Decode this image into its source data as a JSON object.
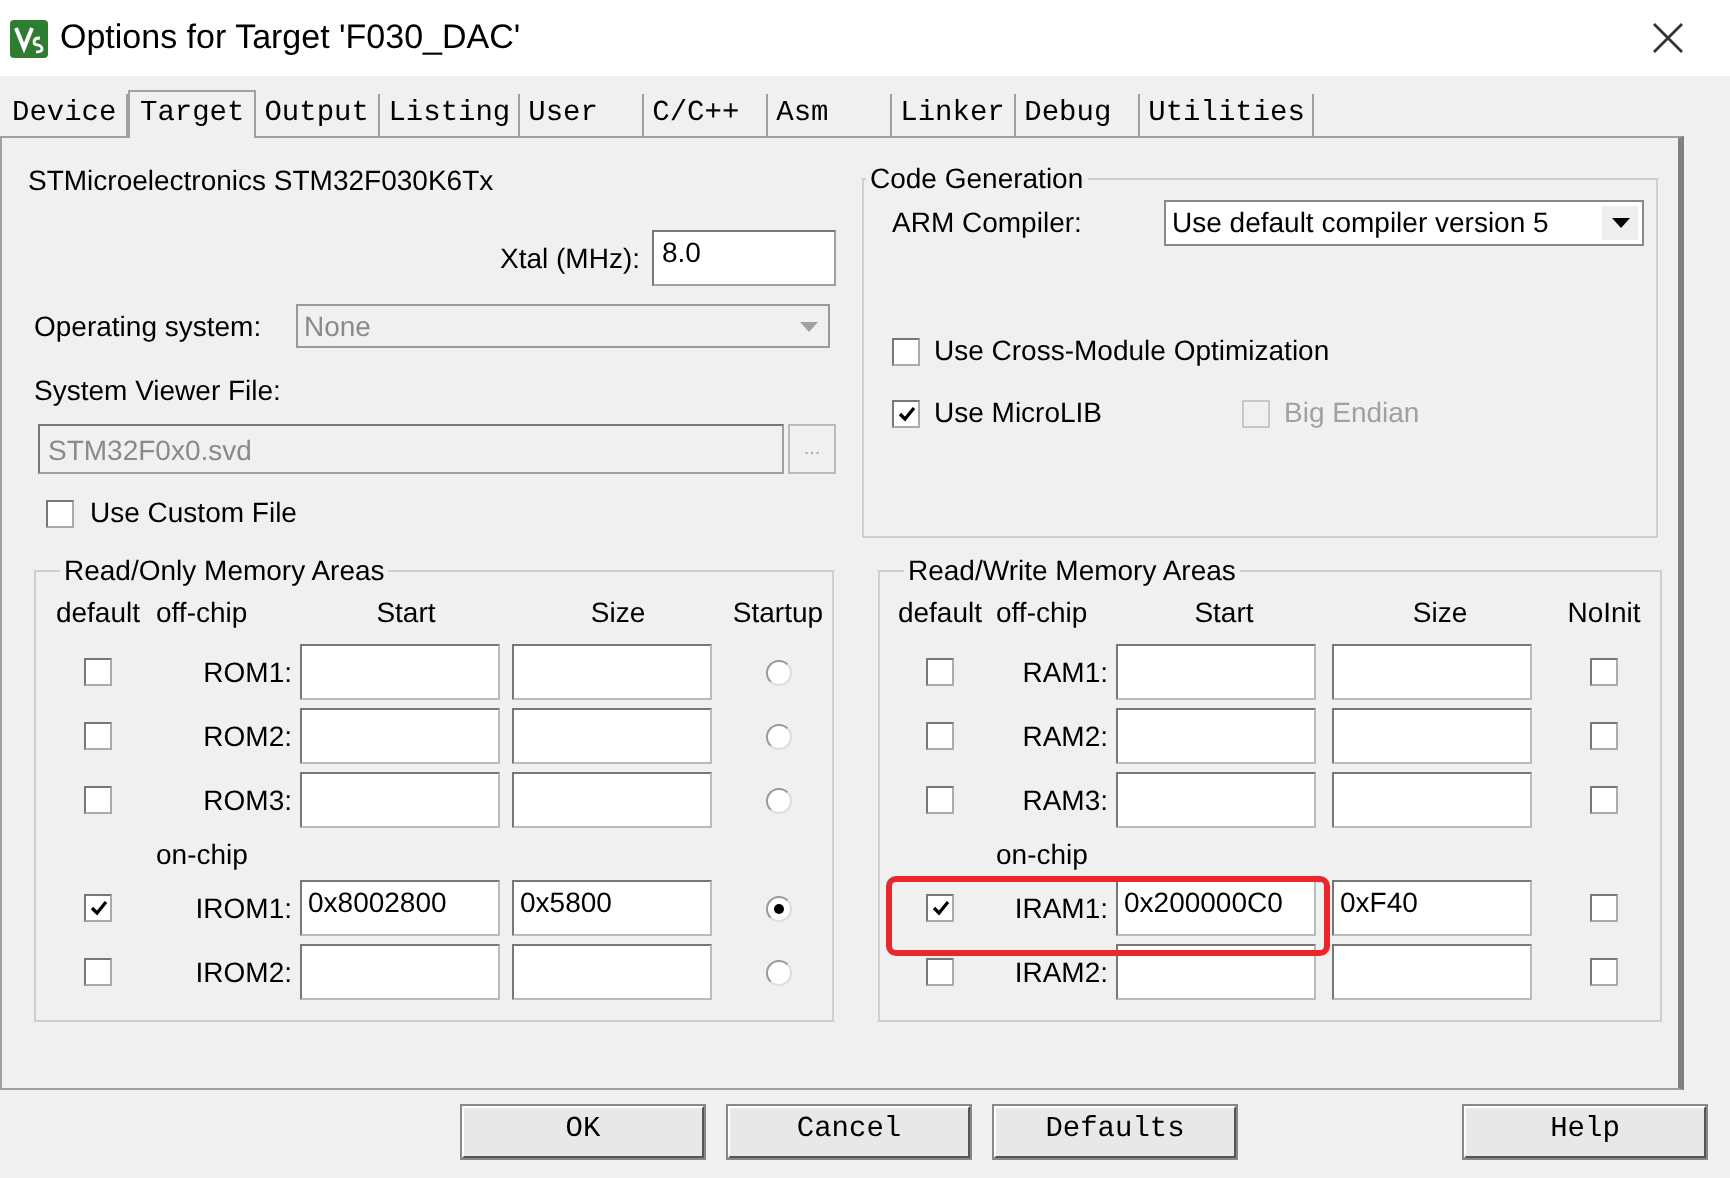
{
  "window": {
    "title": "Options for Target 'F030_DAC'"
  },
  "tabs": [
    {
      "label": "Device",
      "selected": false
    },
    {
      "label": "Target",
      "selected": true
    },
    {
      "label": "Output",
      "selected": false
    },
    {
      "label": "Listing",
      "selected": false
    },
    {
      "label": "User",
      "selected": false
    },
    {
      "label": "C/C++",
      "selected": false
    },
    {
      "label": "Asm",
      "selected": false
    },
    {
      "label": "Linker",
      "selected": false
    },
    {
      "label": "Debug",
      "selected": false
    },
    {
      "label": "Utilities",
      "selected": false
    }
  ],
  "device": {
    "name": "STMicroelectronics STM32F030K6Tx",
    "xtal": {
      "label": "Xtal (MHz):",
      "value": "8.0"
    },
    "os": {
      "label": "Operating system:",
      "value": "None",
      "disabled": true
    },
    "svd": {
      "label": "System Viewer File:",
      "value": "STM32F0x0.svd",
      "disabled": true,
      "browse": "..."
    },
    "custom_file": {
      "label": "Use Custom File",
      "checked": false
    }
  },
  "code_generation": {
    "title": "Code Generation",
    "compiler_label": "ARM Compiler:",
    "compiler": "Use default compiler version 5",
    "options": [
      {
        "label": "Use Cross-Module Optimization",
        "checked": false,
        "disabled": false
      },
      {
        "label": "Use MicroLIB",
        "checked": true,
        "disabled": false
      },
      {
        "label": "Big Endian",
        "checked": false,
        "disabled": true
      }
    ]
  },
  "memory_areas": [
    {
      "title": "Read/Only Memory Areas",
      "columns": [
        "default",
        "off-chip",
        "Start",
        "Size",
        "Startup"
      ],
      "kind": "radio",
      "onchip_label": "on-chip",
      "rows": [
        {
          "kind": "off-chip",
          "label": "ROM1:",
          "default": false,
          "last": false,
          "highlighted": false
        },
        {
          "kind": "off-chip",
          "label": "ROM2:",
          "default": false,
          "last": false,
          "highlighted": false
        },
        {
          "kind": "off-chip",
          "label": "ROM3:",
          "default": false,
          "last": false,
          "highlighted": false
        },
        {
          "kind": "on-chip",
          "label": "IROM1:",
          "default": true,
          "start": "0x8002800",
          "size": "0x5800",
          "last": true,
          "highlighted": false
        },
        {
          "kind": "on-chip",
          "label": "IROM2:",
          "default": false,
          "last": false,
          "highlighted": false
        }
      ]
    },
    {
      "title": "Read/Write Memory Areas",
      "columns": [
        "default",
        "off-chip",
        "Start",
        "Size",
        "NoInit"
      ],
      "kind": "checkbox",
      "onchip_label": "on-chip",
      "rows": [
        {
          "kind": "off-chip",
          "label": "RAM1:",
          "default": false,
          "last": false,
          "highlighted": false
        },
        {
          "kind": "off-chip",
          "label": "RAM2:",
          "default": false,
          "last": false,
          "highlighted": false
        },
        {
          "kind": "off-chip",
          "label": "RAM3:",
          "default": false,
          "last": false,
          "highlighted": false
        },
        {
          "kind": "on-chip",
          "label": "IRAM1:",
          "default": true,
          "start": "0x200000C0",
          "size": "0xF40",
          "last": false,
          "highlighted": true
        },
        {
          "kind": "on-chip",
          "label": "IRAM2:",
          "default": false,
          "last": false,
          "highlighted": false
        }
      ]
    }
  ],
  "buttons": [
    {
      "label": "OK"
    },
    {
      "label": "Cancel"
    },
    {
      "label": "Defaults"
    },
    {
      "label": "Help"
    }
  ]
}
